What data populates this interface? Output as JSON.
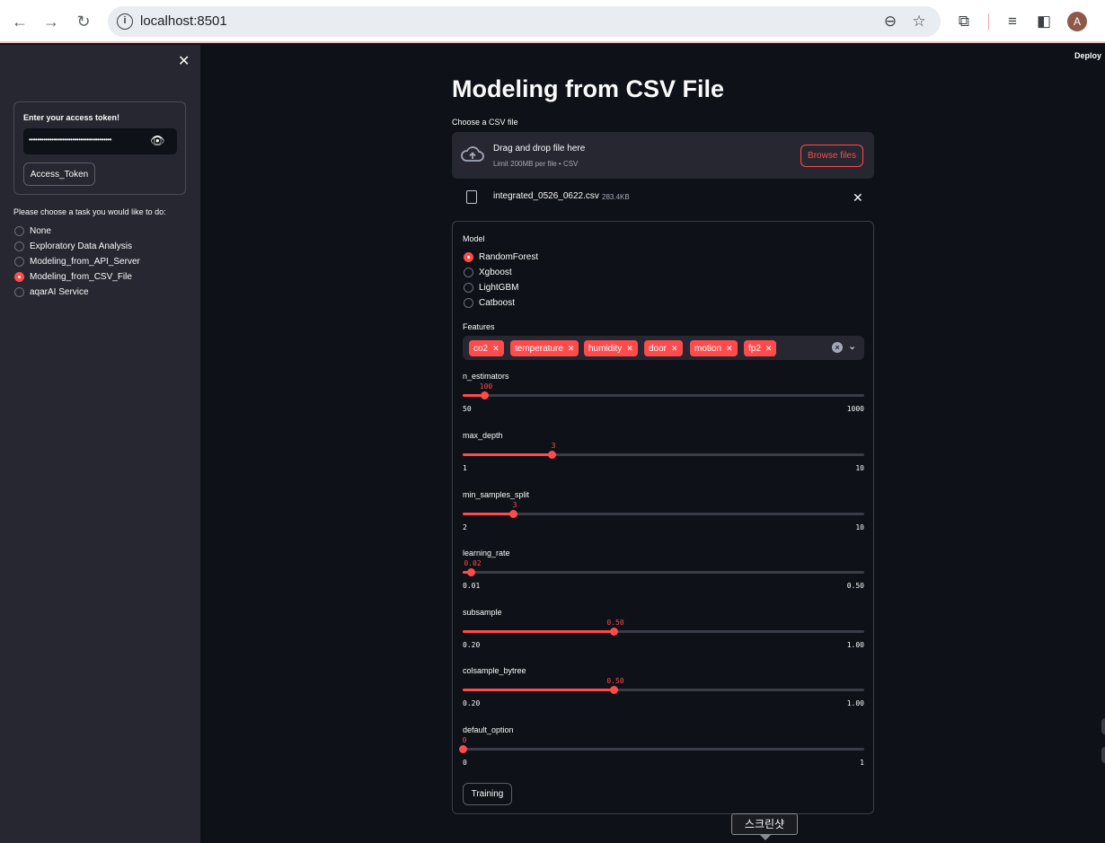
{
  "browser": {
    "url": "localhost:8501",
    "avatar_initial": "A"
  },
  "sidebar": {
    "token_label": "Enter your access token!",
    "token_value": "••••••••••••••••••••••••••••••••••••••••",
    "token_button": "Access_Token",
    "task_label": "Please choose a task you would like to do:",
    "tasks": [
      {
        "label": "None",
        "selected": false
      },
      {
        "label": "Exploratory Data Analysis",
        "selected": false
      },
      {
        "label": "Modeling_from_API_Server",
        "selected": false
      },
      {
        "label": "Modeling_from_CSV_File",
        "selected": true
      },
      {
        "label": "aqarAI Service",
        "selected": false
      }
    ]
  },
  "header": {
    "deploy": "Deploy"
  },
  "main": {
    "title": "Modeling from CSV File",
    "uploader": {
      "label": "Choose a CSV file",
      "drop_title": "Drag and drop file here",
      "drop_sub": "Limit 200MB per file • CSV",
      "browse_label": "Browse files",
      "file_name": "integrated_0526_0622.csv",
      "file_size": "283.4KB"
    },
    "form": {
      "model_label": "Model",
      "models": [
        {
          "label": "RandomForest",
          "selected": true
        },
        {
          "label": "Xgboost",
          "selected": false
        },
        {
          "label": "LightGBM",
          "selected": false
        },
        {
          "label": "Catboost",
          "selected": false
        }
      ],
      "features_label": "Features",
      "features": [
        "co2",
        "temperature",
        "humidity",
        "door",
        "motion",
        "fp2"
      ],
      "sliders": [
        {
          "name": "n_estimators",
          "value": "100",
          "min": "50",
          "max": "1000",
          "frac": 0.0526
        },
        {
          "name": "max_depth",
          "value": "3",
          "min": "1",
          "max": "10",
          "frac": 0.2222
        },
        {
          "name": "min_samples_split",
          "value": "3",
          "min": "2",
          "max": "10",
          "frac": 0.125
        },
        {
          "name": "learning_rate",
          "value": "0.02",
          "min": "0.01",
          "max": "0.50",
          "frac": 0.0204
        },
        {
          "name": "subsample",
          "value": "0.50",
          "min": "0.20",
          "max": "1.00",
          "frac": 0.375
        },
        {
          "name": "colsample_bytree",
          "value": "0.50",
          "min": "0.20",
          "max": "1.00",
          "frac": 0.375
        },
        {
          "name": "default_option",
          "value": "0",
          "min": "0",
          "max": "1",
          "frac": 0
        }
      ],
      "train_label": "Training"
    }
  },
  "tooltip": "스크린샷",
  "colors": {
    "accent": "#ff4b4b",
    "background": "#0e1117",
    "sidebar": "#262730"
  }
}
